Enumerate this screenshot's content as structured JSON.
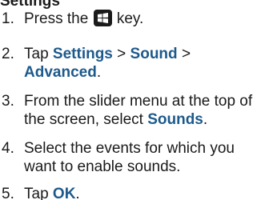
{
  "heading": "Settings",
  "steps": [
    {
      "number": "1.",
      "parts": [
        "Press the",
        "key."
      ],
      "icon": "windows-key-icon"
    },
    {
      "number": "2.",
      "parts": [
        "Tap",
        "Settings",
        ">",
        "Sound",
        ">",
        "Advanced",
        "."
      ]
    },
    {
      "number": "3.",
      "parts": [
        "From the slider menu at the top of",
        "the screen, select",
        "Sounds",
        "."
      ]
    },
    {
      "number": "4.",
      "parts": [
        "Select the events for which you",
        "want to enable sounds."
      ]
    },
    {
      "number": "5.",
      "parts": [
        "Tap",
        "OK",
        "."
      ]
    }
  ],
  "colors": {
    "text": "#1a1a1a",
    "keyword": "#1d5a8c",
    "key_background": "#1b1b1b"
  }
}
